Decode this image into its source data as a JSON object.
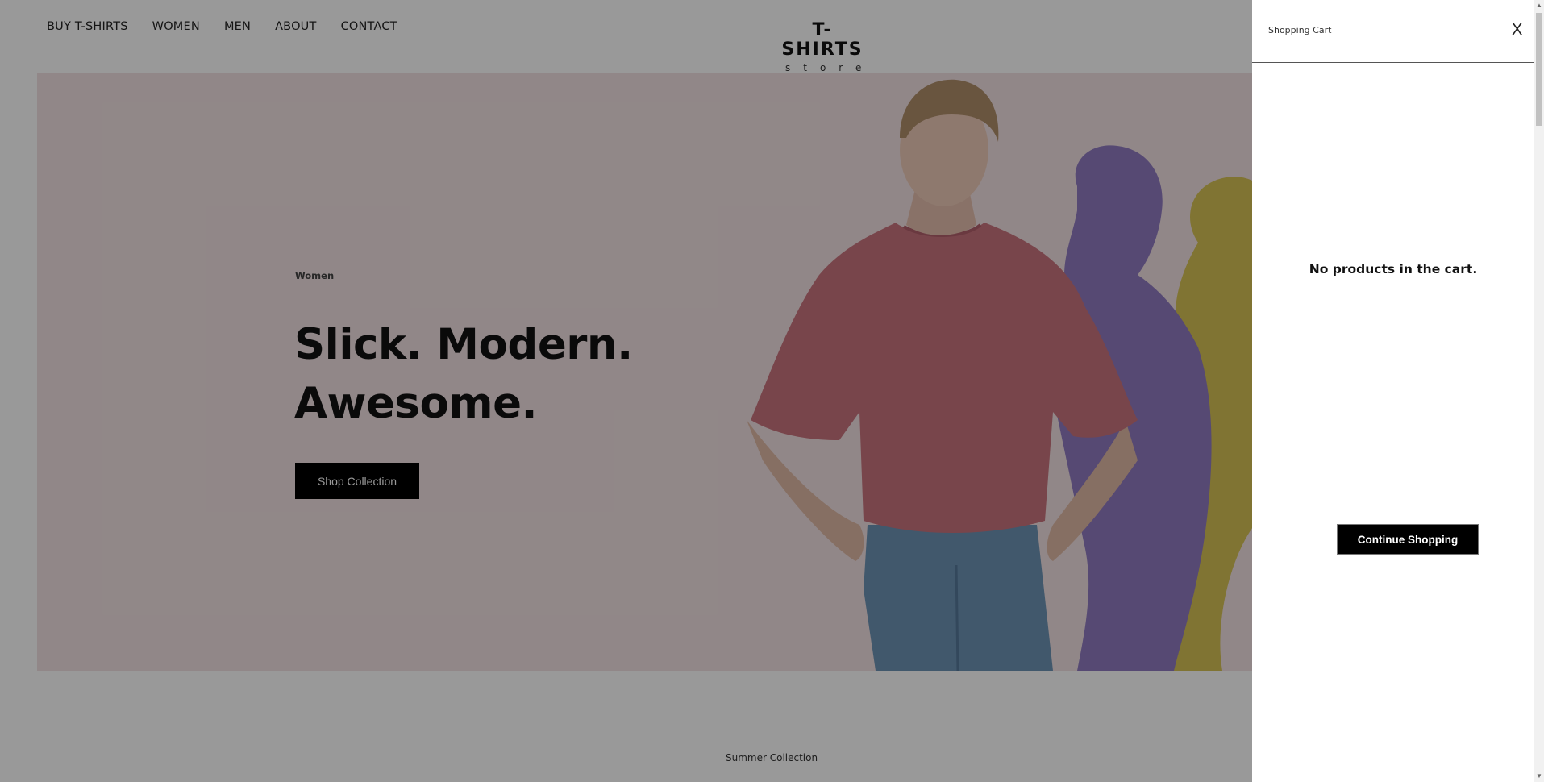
{
  "nav": {
    "items": [
      {
        "label": "BUY T-SHIRTS"
      },
      {
        "label": "WOMEN"
      },
      {
        "label": "MEN"
      },
      {
        "label": "ABOUT"
      },
      {
        "label": "CONTACT"
      }
    ]
  },
  "logo": {
    "main": "T-SHIRTS",
    "sub": "store"
  },
  "hero": {
    "eyebrow": "Women",
    "title_line1": "Slick. Modern.",
    "title_line2": "Awesome.",
    "cta_label": "Shop Collection"
  },
  "section": {
    "label": "Summer Collection"
  },
  "cart": {
    "title": "Shopping Cart",
    "close_label": "X",
    "empty_message": "No products in the cart.",
    "continue_label": "Continue Shopping"
  },
  "colors": {
    "hero_bg": "#f2e2e3",
    "shirt": "#c9737e",
    "jeans": "#6d93b5",
    "purple_silhouette": "#8f7ac0",
    "yellow_silhouette": "#d6c256",
    "overlay": "rgba(0,0,0,0.40)"
  }
}
